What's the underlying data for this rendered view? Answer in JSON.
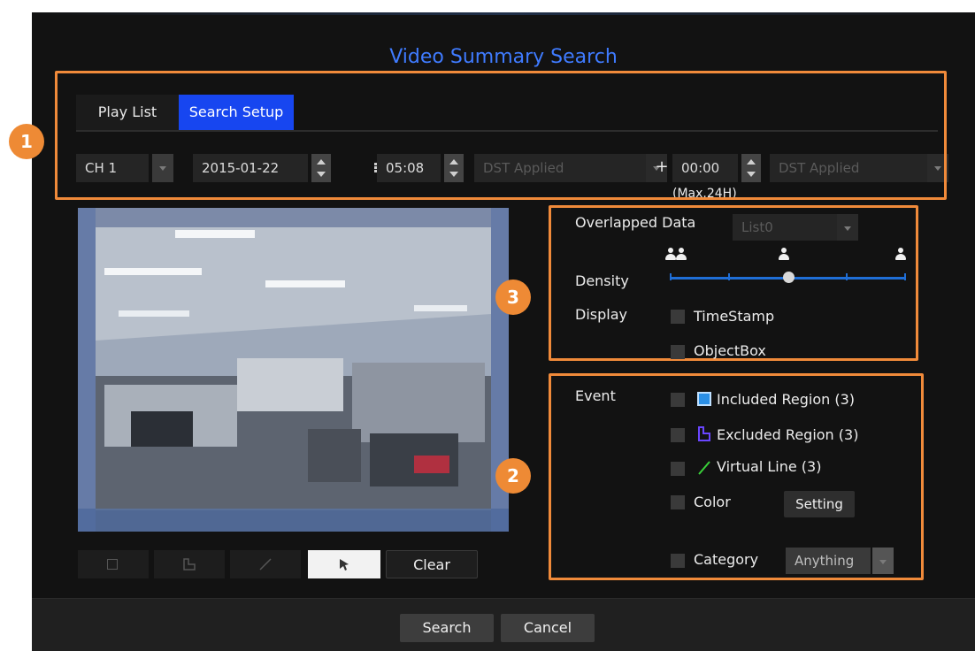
{
  "title": "Video Summary Search",
  "tabs": [
    {
      "label": "Play List",
      "active": false
    },
    {
      "label": "Search Setup",
      "active": true
    }
  ],
  "setup": {
    "channel": "CH 1",
    "date": "2015-01-22",
    "time": "05:08",
    "dst_start": "DST Applied",
    "plus": "+",
    "duration": "00:00",
    "dst_end": "DST Applied",
    "max_note": "(Max.24H)"
  },
  "options": {
    "overlapped_label": "Overlapped Data",
    "overlapped_value": "List0",
    "density_label": "Density",
    "density_level": 0.5,
    "display_label": "Display",
    "timestamp_label": "TimeStamp",
    "objectbox_label": "ObjectBox"
  },
  "event": {
    "label": "Event",
    "included": "Included Region (3)",
    "excluded": "Excluded Region (3)",
    "virtual": "Virtual Line (3)",
    "color_label": "Color",
    "setting_button": "Setting",
    "category_label": "Category",
    "category_value": "Anything"
  },
  "toolbar": {
    "clear": "Clear"
  },
  "footer": {
    "search": "Search",
    "cancel": "Cancel"
  },
  "badges": [
    "1",
    "2",
    "3"
  ],
  "colors": {
    "accent": "#1746f0",
    "title": "#3f7bff",
    "callout": "#f08a3a",
    "slider": "#1f6ed6"
  }
}
